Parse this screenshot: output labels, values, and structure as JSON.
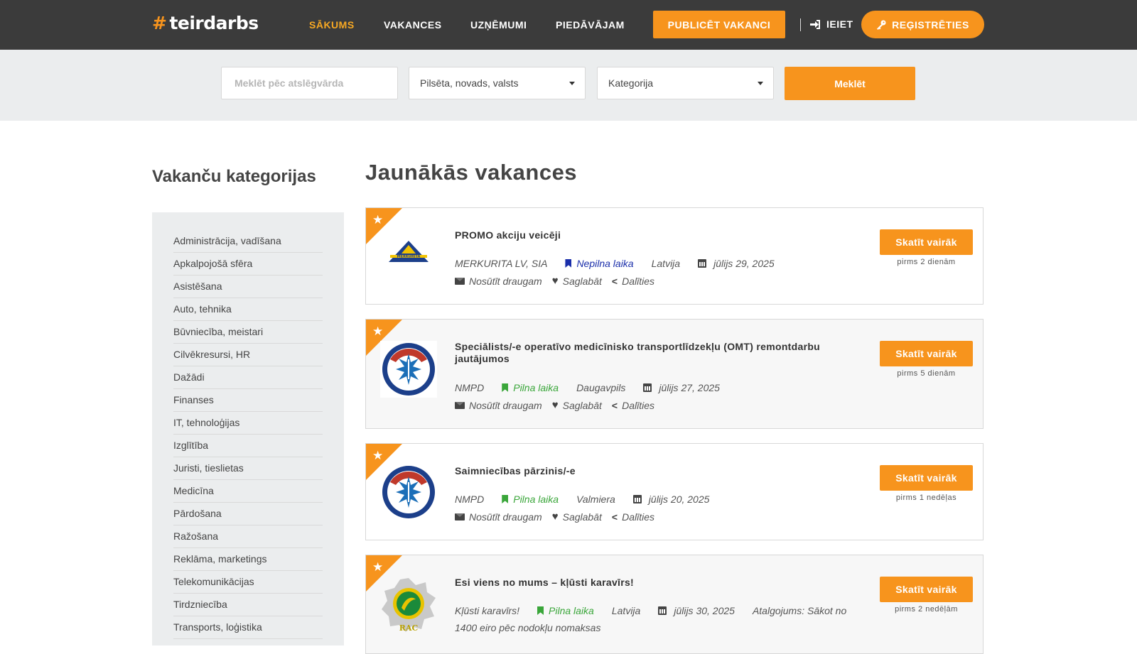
{
  "header": {
    "logo_hash": "#",
    "logo_text": "teirdarbs",
    "nav": [
      "SĀKUMS",
      "VAKANCES",
      "UZŅĒMUMI",
      "PIEDĀVĀJAM"
    ],
    "publish_label": "PUBLICĒT VAKANCI",
    "login_label": "IEIET",
    "register_label": "REĢISTRĒTIES",
    "accent_color": "#f7941d"
  },
  "search": {
    "keyword_placeholder": "Meklēt pēc atslēgvārda",
    "city_value": "Pilsēta, novads, valsts",
    "category_value": "Kategorija",
    "button_label": "Meklēt"
  },
  "sidebar": {
    "title": "Vakanču kategorijas",
    "items": [
      "Administrācija, vadīšana",
      "Apkalpojošā sfēra",
      "Asistēšana",
      "Auto, tehnika",
      "Būvniecība, meistari",
      "Cilvēkresursi, HR",
      "Dažādi",
      "Finanses",
      "IT, tehnoloģijas",
      "Izglītība",
      "Juristi, tieslietas",
      "Medicīna",
      "Pārdošana",
      "Ražošana",
      "Reklāma, marketings",
      "Telekomunikācijas",
      "Tirdzniecība",
      "Transports, loģistika"
    ]
  },
  "main": {
    "title": "Jaunākās vakances",
    "send_label": "Nosūtīt draugam",
    "save_label": "Saglabāt",
    "share_label": "Dalīties",
    "more_label": "Skatīt vairāk",
    "jobs": [
      {
        "title": "PROMO akciju veicēji",
        "company": "MERKURITA LV, SIA",
        "type": "Nepilna laika",
        "location": "Latvija",
        "date": "jūlijs 29, 2025",
        "ago": "pirms 2 dienām",
        "logo_text": "MERKURITA"
      },
      {
        "title": "Speciālists/-e operatīvo medicīnisko transportlīdzekļu (OMT) remontdarbu jautājumos",
        "company": "NMPD",
        "type": "Pilna laika",
        "location": "Daugavpils",
        "date": "jūlijs 27, 2025",
        "ago": "pirms 5 dienām"
      },
      {
        "title": "Saimniecības pārzinis/-e",
        "company": "NMPD",
        "type": "Pilna laika",
        "location": "Valmiera",
        "date": "jūlijs 20, 2025",
        "ago": "pirms 1 nedēļas"
      },
      {
        "title": "Esi viens no mums – kļūsti karavīrs!",
        "company": "Kļūsti karavīrs!",
        "type": "Pilna laika",
        "location": "Latvija",
        "date": "jūlijs 30, 2025",
        "salary": "Atalgojums: Sākot no",
        "salary_cont": "1400 eiro pēc nodokļu nomaksas",
        "ago": "pirms 2 nedēļām",
        "logo_text": "RAC"
      }
    ]
  }
}
